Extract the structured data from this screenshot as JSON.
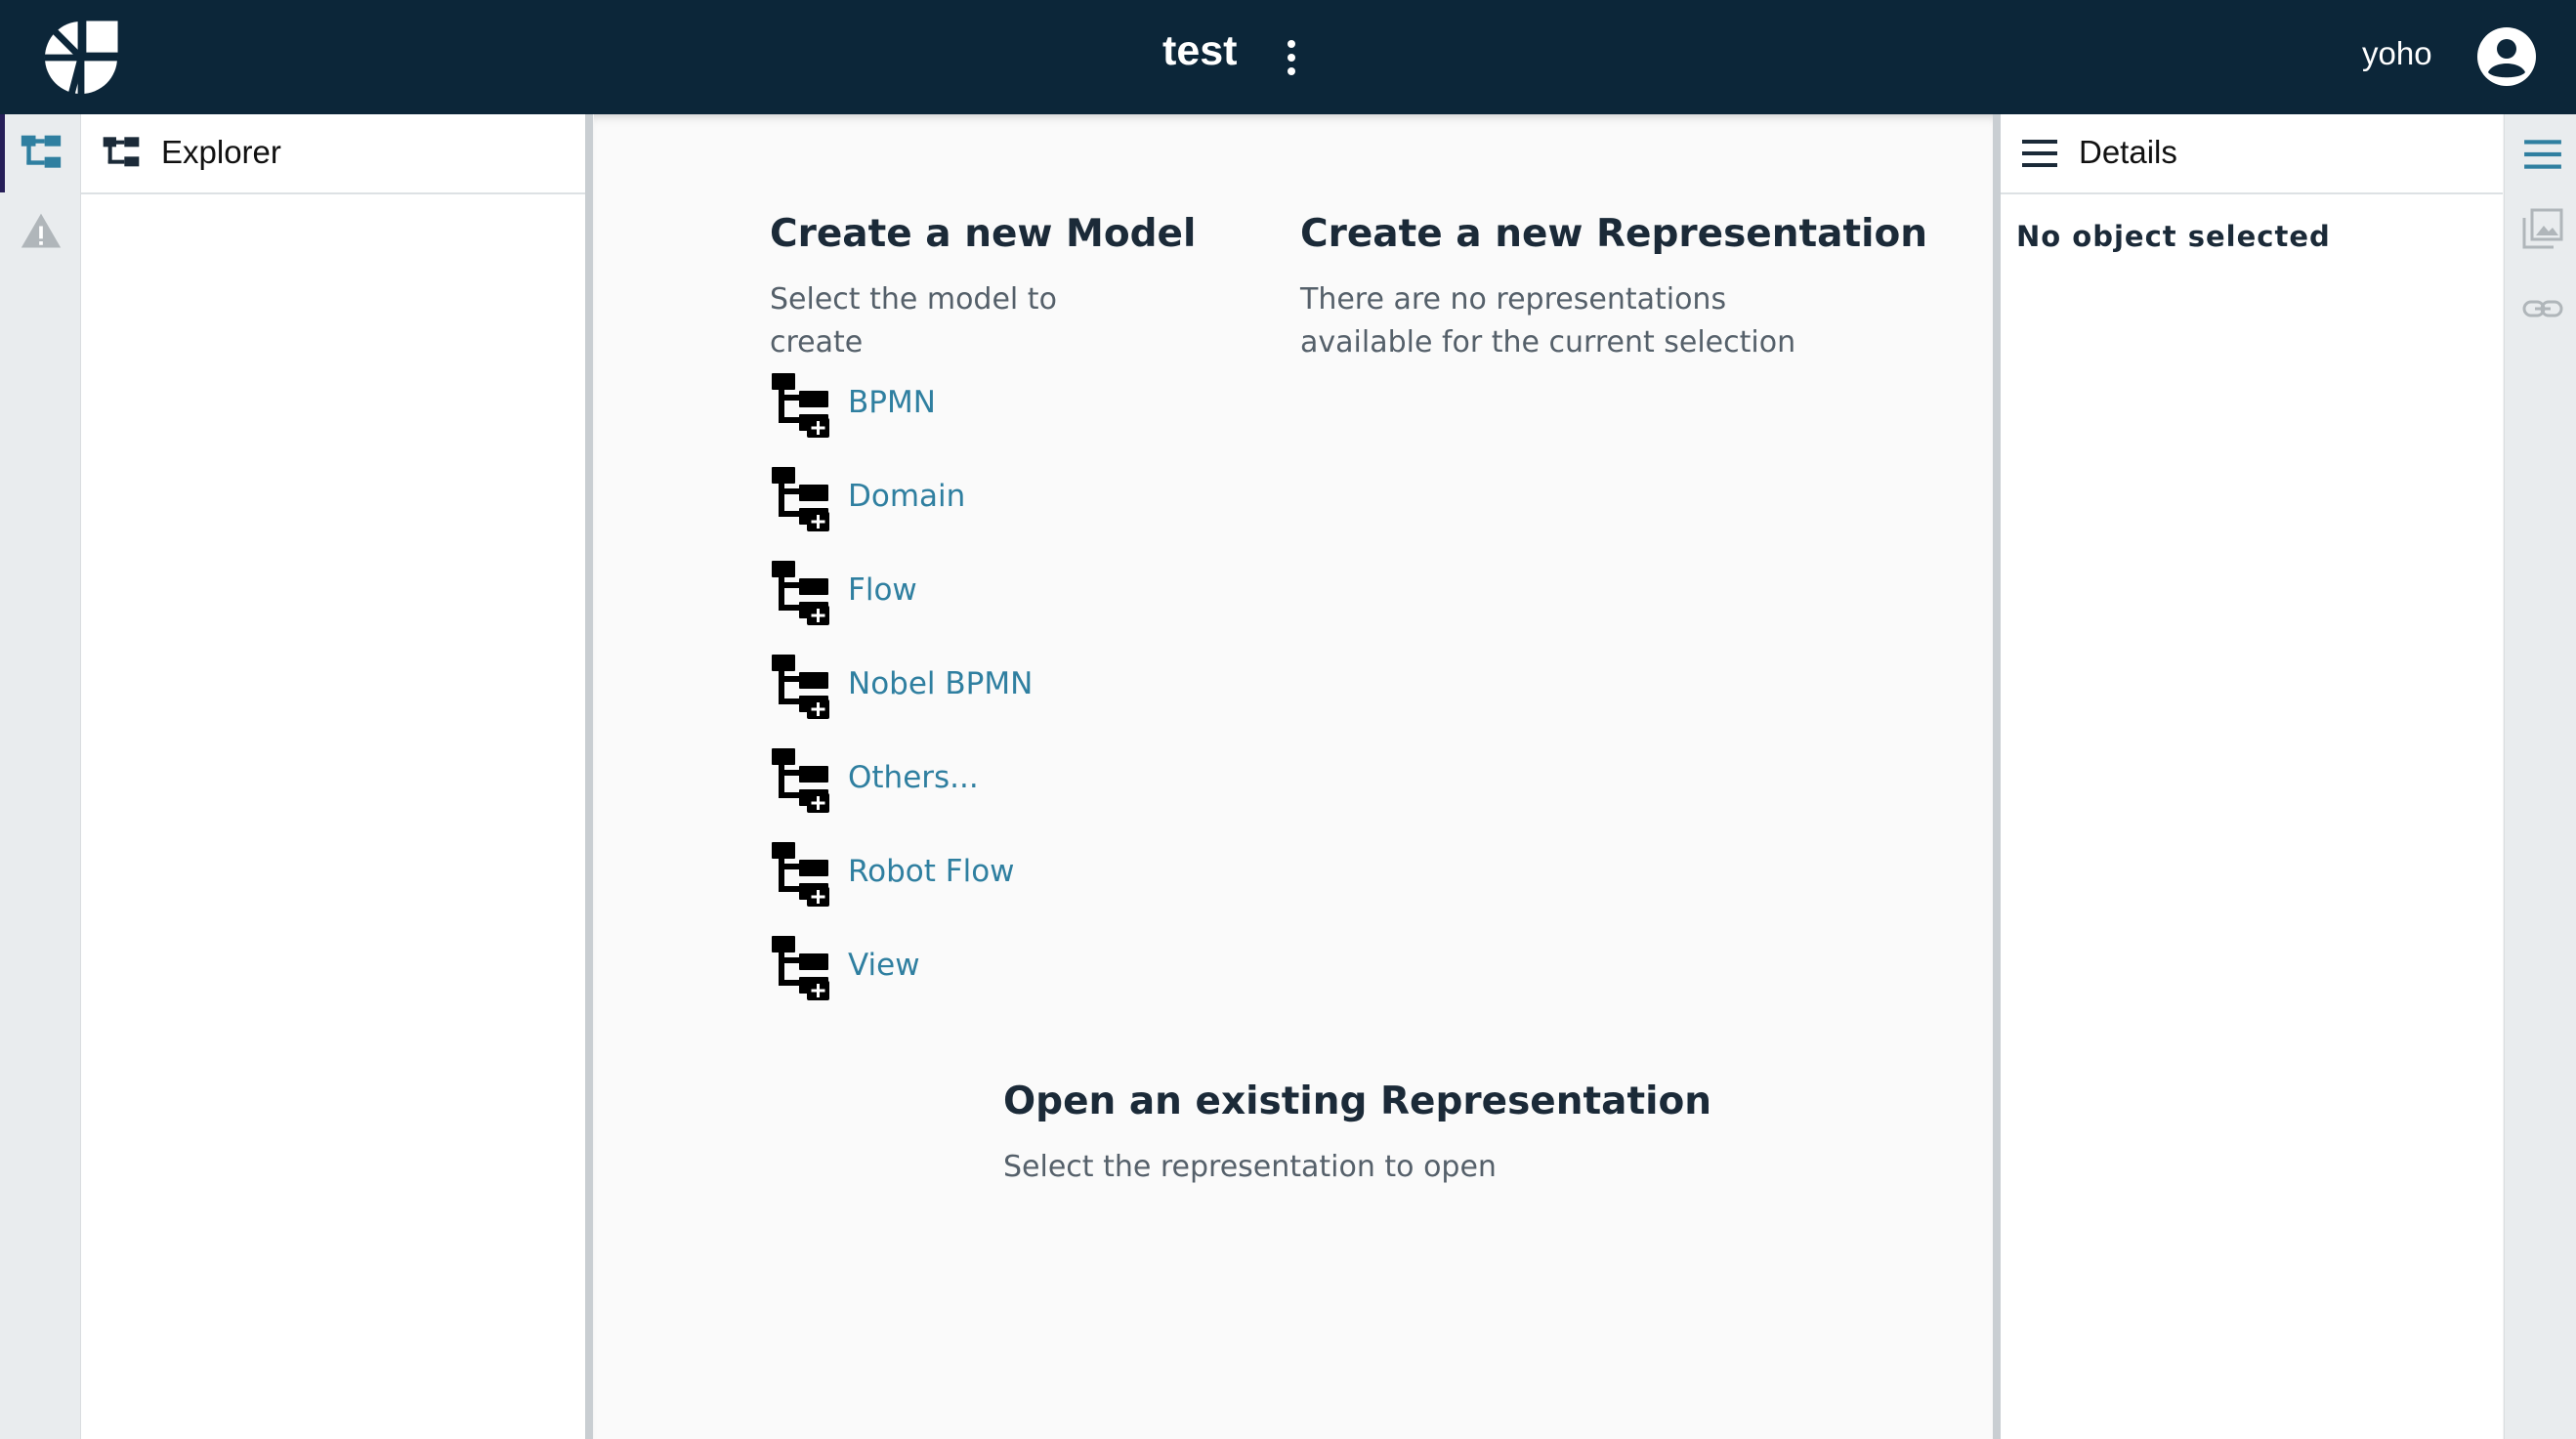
{
  "header": {
    "project_name": "test",
    "username": "yoho",
    "logo_icon": "sirius-logo-icon",
    "menu_icon": "more-vertical-icon",
    "avatar_icon": "account-circle-icon"
  },
  "left_rail": {
    "items": [
      {
        "name": "explorer",
        "icon": "tree-icon",
        "active": true
      },
      {
        "name": "validation",
        "icon": "warning-icon",
        "active": false
      }
    ]
  },
  "explorer": {
    "title": "Explorer",
    "icon": "tree-icon"
  },
  "main": {
    "create_model": {
      "title": "Create a new Model",
      "subtitle_line1": "Select the model to",
      "subtitle_line2": "create",
      "items": [
        {
          "label": "BPMN",
          "icon": "new-model-icon"
        },
        {
          "label": "Domain",
          "icon": "new-model-icon"
        },
        {
          "label": "Flow",
          "icon": "new-model-icon"
        },
        {
          "label": "Nobel BPMN",
          "icon": "new-model-icon"
        },
        {
          "label": "Others...",
          "icon": "new-model-icon"
        },
        {
          "label": "Robot Flow",
          "icon": "new-model-icon"
        },
        {
          "label": "View",
          "icon": "new-model-icon"
        }
      ]
    },
    "create_representation": {
      "title": "Create a new Representation",
      "subtitle_line1": "There are no representations",
      "subtitle_line2": "available for the current selection"
    },
    "open_representation": {
      "title": "Open an existing Representation",
      "subtitle": "Select the representation to open"
    }
  },
  "details": {
    "title": "Details",
    "icon": "menu-icon",
    "empty_text": "No object selected"
  },
  "right_rail": {
    "items": [
      {
        "name": "details",
        "icon": "menu-icon",
        "active": true
      },
      {
        "name": "representations",
        "icon": "image-gallery-icon",
        "active": false
      },
      {
        "name": "related-elements",
        "icon": "link-icon",
        "active": false
      }
    ]
  },
  "colors": {
    "topbar": "#0c2639",
    "link": "#2f7fa0",
    "active_icon": "#2f7fa0",
    "inactive_icon": "#b0b6ba"
  }
}
